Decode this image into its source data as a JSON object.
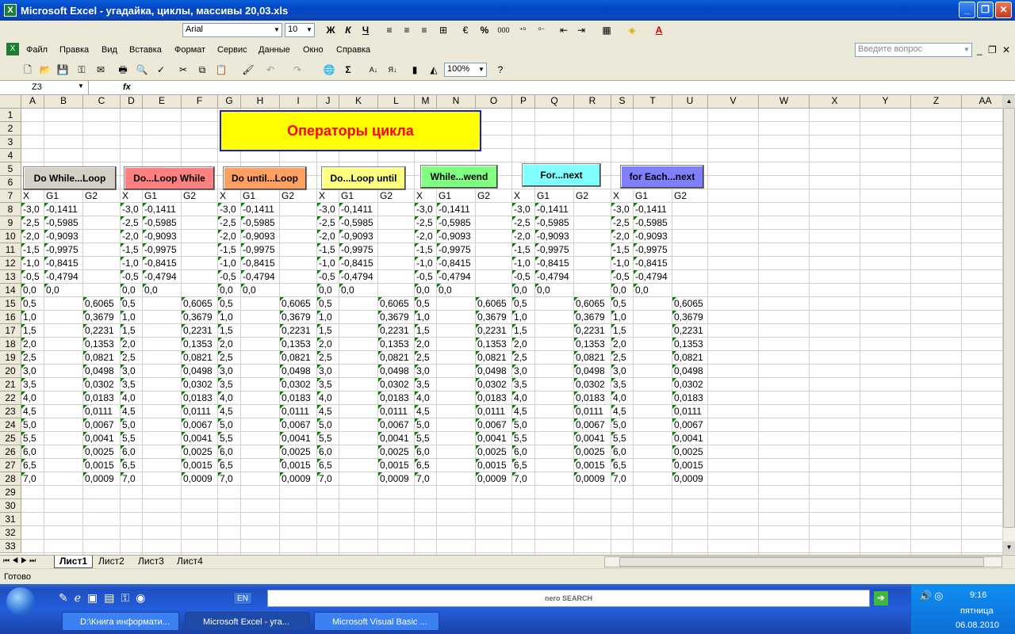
{
  "window": {
    "title": "Microsoft Excel - угадайка, циклы, массивы 20,03.xls"
  },
  "format_toolbar": {
    "font": "Arial",
    "size": "10",
    "bold": "Ж",
    "italic": "К",
    "underline": "Ч",
    "percent": "%",
    "thousands": "000"
  },
  "menu": [
    "Файл",
    "Правка",
    "Вид",
    "Вставка",
    "Формат",
    "Сервис",
    "Данные",
    "Окно",
    "Справка"
  ],
  "help_placeholder": "Введите вопрос",
  "standard_toolbar": {
    "zoom": "100%",
    "sum": "Σ"
  },
  "formula_bar": {
    "name_box": "Z3",
    "fx": "fx",
    "value": ""
  },
  "columns": [
    "A",
    "B",
    "C",
    "D",
    "E",
    "F",
    "G",
    "H",
    "I",
    "J",
    "K",
    "L",
    "M",
    "N",
    "O",
    "P",
    "Q",
    "R",
    "S",
    "T",
    "U",
    "V",
    "W",
    "X",
    "Y",
    "Z",
    "AA"
  ],
  "rows": [
    "1",
    "2",
    "3",
    "4",
    "5",
    "6",
    "7",
    "8",
    "9",
    "10",
    "11",
    "12",
    "13",
    "14",
    "15",
    "16",
    "17",
    "18",
    "19",
    "20",
    "21",
    "22",
    "23",
    "24",
    "25",
    "26",
    "27",
    "28",
    "29",
    "30",
    "31",
    "32",
    "33"
  ],
  "title_box": "Операторы цикла",
  "macro_buttons": [
    {
      "label": "Do While...Loop",
      "color": "#d4d0c8"
    },
    {
      "label": "Do...Loop While",
      "color": "#ff8080"
    },
    {
      "label": "Do until...Loop",
      "color": "#ffa060"
    },
    {
      "label": "Do...Loop until",
      "color": "#ffff80"
    },
    {
      "label": "While...wend",
      "color": "#80ff80"
    },
    {
      "label": "For...next",
      "color": "#80ffff"
    },
    {
      "label": "for Each...next",
      "color": "#8080ff"
    }
  ],
  "header_labels": [
    "X",
    "G1",
    "G2"
  ],
  "x_neg": [
    "-3,0",
    "-2,5",
    "-2,0",
    "-1,5",
    "-1,0",
    "-0,5",
    "0,0"
  ],
  "g1": [
    "-0,1411",
    "-0,5985",
    "-0,9093",
    "-0,9975",
    "-0,8415",
    "-0,4794",
    "0,0"
  ],
  "x_pos": [
    "0,5",
    "1,0",
    "1,5",
    "2,0",
    "2,5",
    "3,0",
    "3,5",
    "4,0",
    "4,5",
    "5,0",
    "5,5",
    "6,0",
    "6,5",
    "7,0"
  ],
  "g2": [
    "0,6065",
    "0,3679",
    "0,2231",
    "0,1353",
    "0,0821",
    "0,0498",
    "0,0302",
    "0,0183",
    "0,0111",
    "0,0067",
    "0,0041",
    "0,0025",
    "0,0015",
    "0,0009"
  ],
  "sheets": [
    "Лист1",
    "Лист2",
    "Лист3",
    "Лист4"
  ],
  "status": "Готово",
  "taskbar": {
    "lang": "EN",
    "tasks": [
      "D:\\Книга информати...",
      "Microsoft Excel - уга...",
      "Microsoft Visual Basic ..."
    ],
    "nero": "nero SEARCH",
    "time": "9:16",
    "day": "пятница",
    "date": "06.08.2010"
  }
}
